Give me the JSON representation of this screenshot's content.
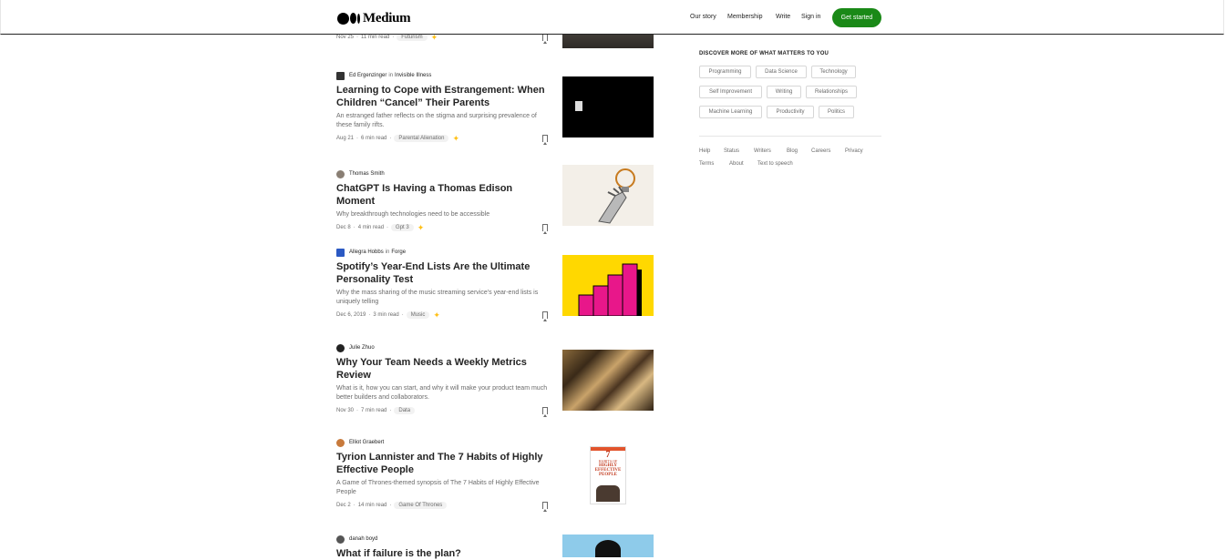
{
  "nav": {
    "brand": "Medium",
    "links": [
      "Our story",
      "Membership",
      "Write",
      "Sign in"
    ],
    "cta": "Get started"
  },
  "top_article": {
    "date": "Nov 25",
    "read_time": "11 min read",
    "tag": "Futurism"
  },
  "articles": [
    {
      "author": "Ed Ergenzinger",
      "in": "in",
      "publication": "Invisible Illness",
      "title": "Learning to Cope with Estrangement: When Children “Cancel” Their Parents",
      "subtitle": "An estranged father reflects on the stigma and surprising prevalence of these family rifts.",
      "date": "Aug 21",
      "read_time": "6 min read",
      "tag": "Parental Alienation",
      "member_only": true
    },
    {
      "author": "Thomas Smith",
      "in": "",
      "publication": "",
      "title": "ChatGPT Is Having a Thomas Edison Moment",
      "subtitle": "Why breakthrough technologies need to be accessible",
      "date": "Dec 8",
      "read_time": "4 min read",
      "tag": "Gpt 3",
      "member_only": true
    },
    {
      "author": "Allegra Hobbs",
      "in": "in",
      "publication": "Forge",
      "title": "Spotify’s Year-End Lists Are the Ultimate Personality Test",
      "subtitle": "Why the mass sharing of the music streaming service’s year-end lists is uniquely telling",
      "date": "Dec 6, 2019",
      "read_time": "3 min read",
      "tag": "Music",
      "member_only": true
    },
    {
      "author": "Julie Zhuo",
      "in": "",
      "publication": "",
      "title": "Why Your Team Needs a Weekly Metrics Review",
      "subtitle": "What is it, how you can start, and why it will make your product team much better builders and collaborators.",
      "date": "Nov 30",
      "read_time": "7 min read",
      "tag": "Data",
      "member_only": false
    },
    {
      "author": "Elliot Graebert",
      "in": "",
      "publication": "",
      "title": "Tyrion Lannister and The 7 Habits of Highly Effective People",
      "subtitle": "A Game of Thrones-themed synopsis of The 7 Habits of Highly Effective People",
      "date": "Dec 2",
      "read_time": "14 min read",
      "tag": "Game Of Thrones",
      "member_only": false
    },
    {
      "author": "danah boyd",
      "in": "",
      "publication": "",
      "title": "What if failure is the plan?"
    }
  ],
  "book_cover": {
    "number": "7",
    "line1": "HABITS OF",
    "line2": "HIGHLY",
    "line3": "EFFECTIVE",
    "line4": "PEOPLE"
  },
  "sidebar": {
    "heading": "DISCOVER MORE OF WHAT MATTERS TO YOU",
    "topics": [
      "Programming",
      "Data Science",
      "Technology",
      "Self Improvement",
      "Writing",
      "Relationships",
      "Machine Learning",
      "Productivity",
      "Politics"
    ],
    "footer_links": [
      "Help",
      "Status",
      "Writers",
      "Blog",
      "Careers",
      "Privacy",
      "Terms",
      "About",
      "Text to speech"
    ]
  },
  "colors": {
    "brand_green": "#1a8917",
    "member_star": "#ffc017",
    "text": "#242424",
    "muted": "#6b6b6b"
  }
}
